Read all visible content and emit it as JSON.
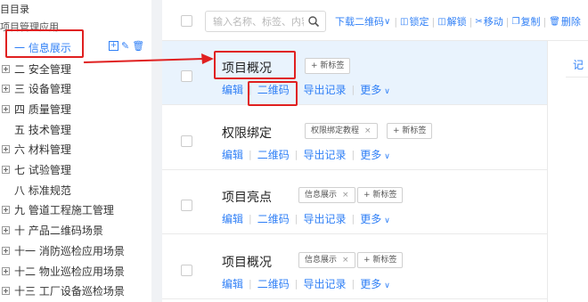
{
  "sidebar": {
    "title": "目目录",
    "subtitle": "项目管理应用",
    "active_item": "一 信息展示",
    "items": [
      {
        "label": "二 安全管理",
        "expandable": true
      },
      {
        "label": "三 设备管理",
        "expandable": true
      },
      {
        "label": "四 质量管理",
        "expandable": true
      },
      {
        "label": "五 技术管理",
        "expandable": false
      },
      {
        "label": "六 材料管理",
        "expandable": true
      },
      {
        "label": "七 试验管理",
        "expandable": true
      },
      {
        "label": "八 标准规范",
        "expandable": false
      },
      {
        "label": "九 管道工程施工管理",
        "expandable": true
      },
      {
        "label": "十 产品二维码场景",
        "expandable": true
      },
      {
        "label": "十一 消防巡检应用场景",
        "expandable": true
      },
      {
        "label": "十二 物业巡检应用场景",
        "expandable": true
      },
      {
        "label": "十三 工厂设备巡检场景",
        "expandable": true
      }
    ]
  },
  "toolbar": {
    "search_placeholder": "输入名称、标签、内容",
    "download_qr": "下载二维码",
    "lock": "锁定",
    "unlock": "解锁",
    "move": "移动",
    "copy": "复制",
    "delete": "删除"
  },
  "list": {
    "items": [
      {
        "title": "项目概况",
        "tags": [],
        "add_tag": "+ 新标签",
        "selected": true
      },
      {
        "title": "权限绑定",
        "tags": [
          "权限绑定教程"
        ],
        "add_tag": "+ 新标签",
        "selected": false
      },
      {
        "title": "项目亮点",
        "tags": [
          "信息展示"
        ],
        "add_tag": "+ 新标签",
        "selected": false
      },
      {
        "title": "项目概况",
        "tags": [
          "信息展示"
        ],
        "add_tag": "+ 新标签",
        "selected": false
      }
    ],
    "actions": {
      "edit": "编辑",
      "qrcode": "二维码",
      "export": "导出记录",
      "more": "更多"
    }
  },
  "right_pane": {
    "tab_label": "记"
  },
  "colors": {
    "accent": "#2f7ff6",
    "selected_row": "#e9f3fd",
    "annotation": "#e02020"
  }
}
